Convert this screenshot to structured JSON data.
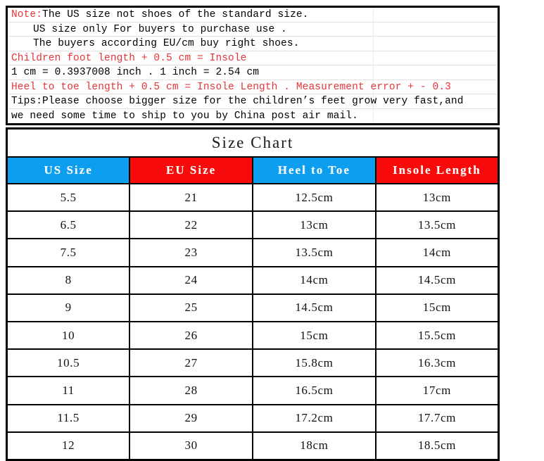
{
  "notes": {
    "lines": [
      {
        "indent": false,
        "segments": [
          {
            "text": "Note:",
            "color": "red"
          },
          {
            "text": "The US size not shoes of the standard size.",
            "color": "black"
          }
        ]
      },
      {
        "indent": true,
        "segments": [
          {
            "text": "US size only For buyers to purchase use .",
            "color": "black"
          }
        ]
      },
      {
        "indent": true,
        "segments": [
          {
            "text": "The buyers according EU/cm buy right shoes.",
            "color": "black"
          }
        ]
      },
      {
        "indent": false,
        "segments": [
          {
            "text": "Children foot length + 0.5 cm = Insole",
            "color": "red"
          }
        ]
      },
      {
        "indent": false,
        "segments": [
          {
            "text": "1 cm = 0.3937008 inch .   1 inch = 2.54 cm",
            "color": "black"
          }
        ]
      },
      {
        "indent": false,
        "segments": [
          {
            "text": "Heel to toe length + 0.5 cm = Insole Length . Measurement error + - 0.3",
            "color": "red"
          }
        ]
      },
      {
        "indent": false,
        "segments": [
          {
            "text": "Tips:Please choose bigger size for the children’s feet grow very fast,and",
            "color": "black"
          }
        ]
      },
      {
        "indent": false,
        "segments": [
          {
            "text": "we need some time to ship to you by China post air mail.",
            "color": "black"
          }
        ]
      }
    ]
  },
  "table": {
    "title": "Size Chart",
    "headers": [
      {
        "label": "US Size",
        "bg": "blue"
      },
      {
        "label": "EU Size",
        "bg": "red"
      },
      {
        "label": "Heel to Toe",
        "bg": "blue"
      },
      {
        "label": "Insole Length",
        "bg": "red"
      }
    ],
    "rows": [
      [
        "5.5",
        "21",
        "12.5cm",
        "13cm"
      ],
      [
        "6.5",
        "22",
        "13cm",
        "13.5cm"
      ],
      [
        "7.5",
        "23",
        "13.5cm",
        "14cm"
      ],
      [
        "8",
        "24",
        "14cm",
        "14.5cm"
      ],
      [
        "9",
        "25",
        "14.5cm",
        "15cm"
      ],
      [
        "10",
        "26",
        "15cm",
        "15.5cm"
      ],
      [
        "10.5",
        "27",
        "15.8cm",
        "16.3cm"
      ],
      [
        "11",
        "28",
        "16.5cm",
        "17cm"
      ],
      [
        "11.5",
        "29",
        "17.2cm",
        "17.7cm"
      ],
      [
        "12",
        "30",
        "18cm",
        "18.5cm"
      ]
    ]
  },
  "colors": {
    "header_blue": "#0d9ef0",
    "header_red": "#f60a0a",
    "note_red": "#e8353a",
    "border_black": "#000000"
  }
}
